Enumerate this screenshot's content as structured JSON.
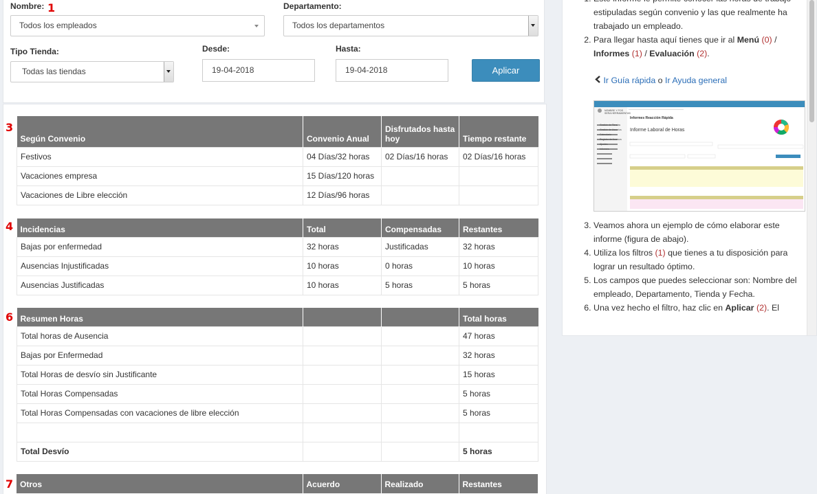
{
  "filters": {
    "nombre_label": "Nombre:",
    "nombre_num": "1",
    "nombre_value": "Todos los empleados",
    "departamento_label": "Departamento:",
    "departamento_value": "Todos los departamentos",
    "tipo_label": "Tipo Tienda:",
    "tipo_value": "Todas las tiendas",
    "desde_label": "Desde:",
    "desde_value": "19-04-2018",
    "hasta_label": "Hasta:",
    "hasta_value": "19-04-2018",
    "apply_label": "Aplicar"
  },
  "sections": {
    "convenio": {
      "num": "3",
      "headers": [
        "Según Convenio",
        "Convenio Anual",
        "Disfrutados hasta hoy",
        "Tiempo restante"
      ],
      "rows": [
        [
          "Festivos",
          "04 Días/32 horas",
          "02 Días/16 horas",
          "02 Días/16 horas"
        ],
        [
          "Vacaciones empresa",
          "15 Días/120 horas",
          "",
          ""
        ],
        [
          "Vacaciones de Libre elección",
          "12 Días/96 horas",
          "",
          ""
        ]
      ]
    },
    "incidencias": {
      "num": "4",
      "headers": [
        "Incidencias",
        "Total",
        "Compensadas",
        "Restantes"
      ],
      "rows": [
        [
          "Bajas por enfermedad",
          "32 horas",
          "Justificadas",
          "32 horas"
        ],
        [
          "Ausencias Injustificadas",
          "10 horas",
          "0 horas",
          "10 horas"
        ],
        [
          "Ausencias Justificadas",
          "10 horas",
          "5 horas",
          "5 horas"
        ]
      ]
    },
    "resumen": {
      "num": "6",
      "headers": [
        "Resumen Horas",
        "",
        "",
        "Total horas"
      ],
      "rows": [
        [
          "Total horas de Ausencia",
          "",
          "",
          "47 horas"
        ],
        [
          "Bajas por Enfermedad",
          "",
          "",
          "32 horas"
        ],
        [
          "Total Horas de desvío sin Justificante",
          "",
          "",
          "15 horas"
        ],
        [
          "Total Horas Compensadas",
          "",
          "",
          "5 horas"
        ],
        [
          "Total Horas Compensadas con vacaciones de libre elección",
          "",
          "",
          "5 horas"
        ]
      ],
      "total_label": "Total Desvío",
      "total_value": "5 horas"
    },
    "otros": {
      "num": "7",
      "headers": [
        "Otros",
        "Acuerdo",
        "Realizado",
        "Restantes"
      ]
    }
  },
  "help": {
    "item1": "Este informe le permite conocer las horas de trabajo estipuladas según convenio y las que realmente ha trabajado un empleado.",
    "item2_pre": "Para llegar hasta aquí tienes que ir al ",
    "item2_menu": "Menú",
    "item2_n0": "(0)",
    "item2_slash1": " / ",
    "item2_informes": "Informes",
    "item2_n1": "(1)",
    "item2_slash2": " / ",
    "item2_evaluacion": "Evaluación",
    "item2_n2": "(2)",
    "item2_end": ".",
    "guide_link": "Ir Guía rápida",
    "guide_o": " o ",
    "help_link": "Ir Ayuda general",
    "item3": "Veamos ahora un ejemplo de cómo elaborar este informe (figura de abajo).",
    "item4_pre": "Utiliza los filtros ",
    "item4_n": "(1)",
    "item4_post": " que tienes a tu disposición para lograr un resultado óptimo.",
    "item5": "Los campos que puedes seleccionar son: Nombre del empleado, Departamento, Tienda y Fecha.",
    "item6_pre": "Una vez hecho el filtro, haz clic en ",
    "item6_bold": "Aplicar",
    "item6_n": "(2)",
    "item6_post": ". El",
    "thumb": {
      "brand": "≡ ● MENU",
      "title": "Informes Reacción Rápida",
      "subtitle": "Informe Laboral de Horas",
      "user_line1": "NOMBRE Y POS",
      "user_line2": "SERA HERRAMIENTAS",
      "apply": "Aplicar",
      "nav": [
        "Gestión de Tiendas",
        "Gestión de Usuarios",
        "Calendario",
        "Registro de Accesos",
        "Ajustes",
        "Informes"
      ]
    }
  }
}
